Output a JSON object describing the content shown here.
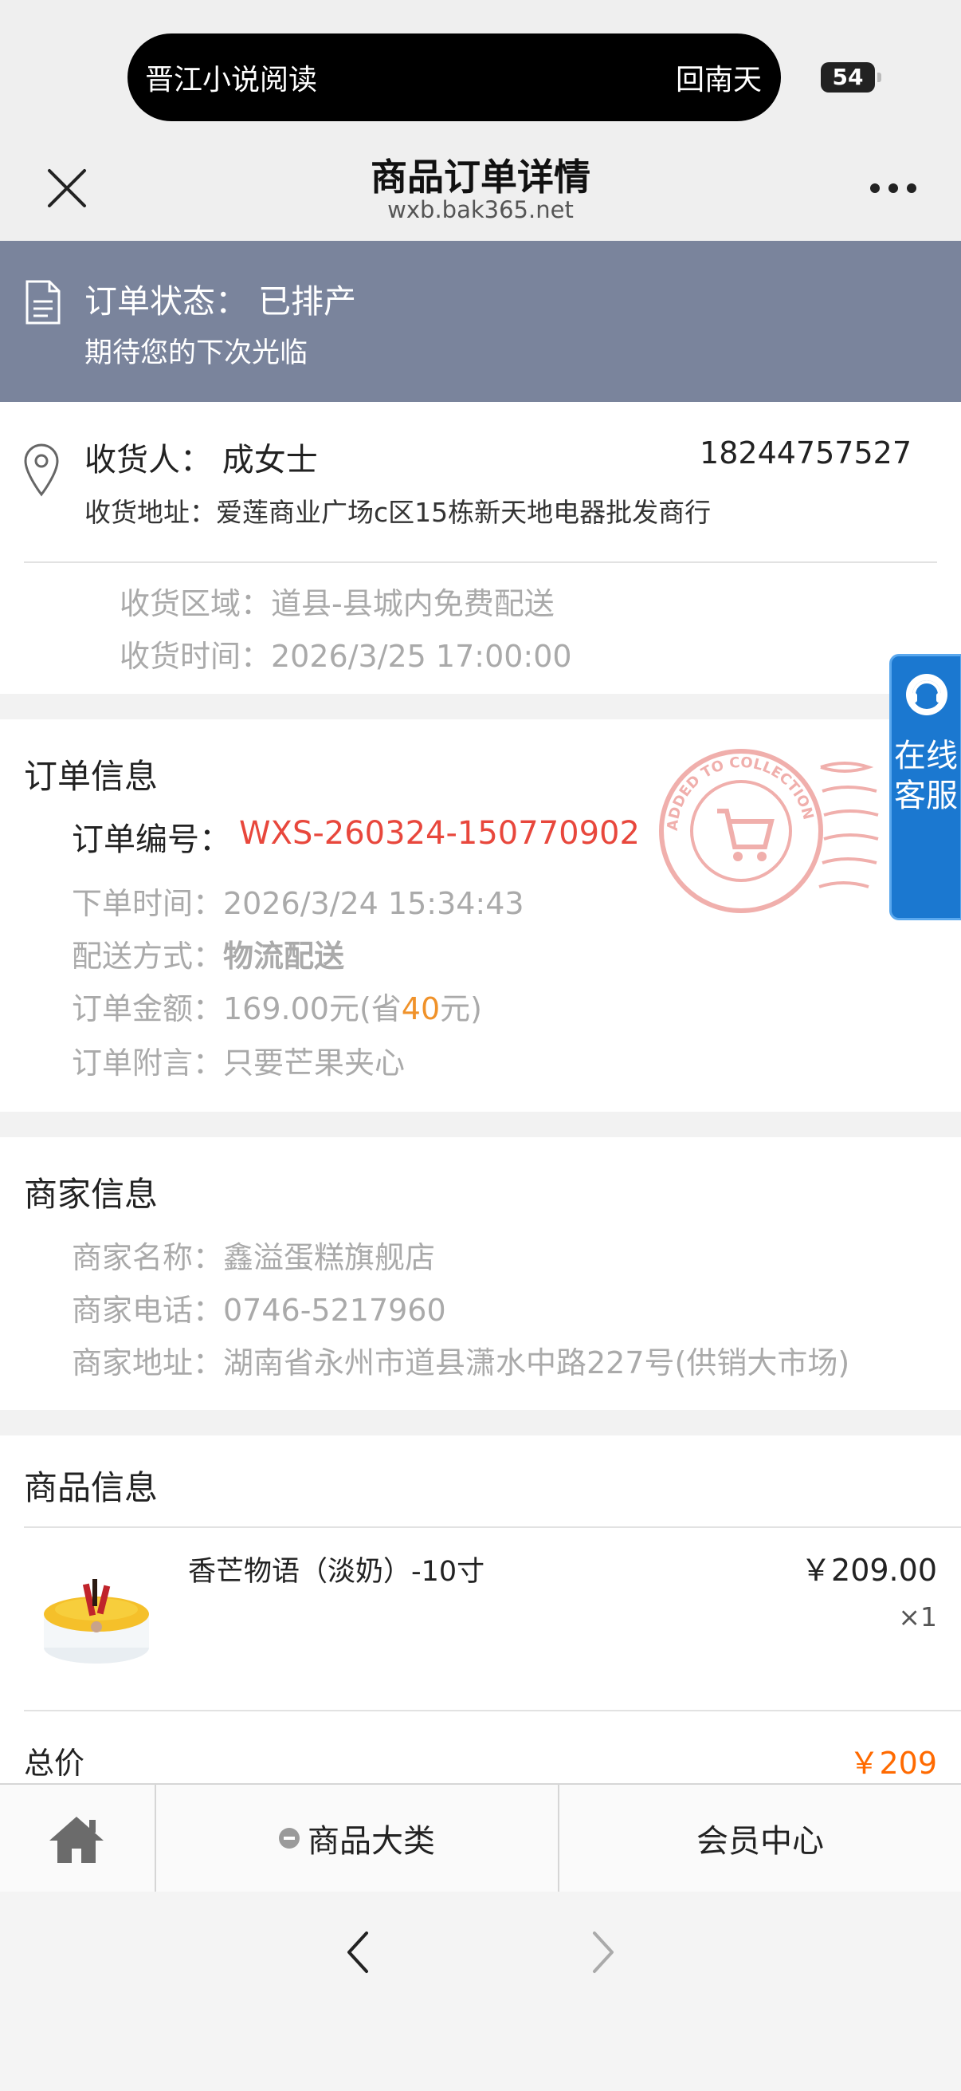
{
  "status_bar": {
    "left_text": "晋江小说阅读",
    "right_text": "回南天",
    "battery": "54"
  },
  "nav": {
    "title": "商品订单详情",
    "subtitle": "wxb.bak365.net"
  },
  "order_status": {
    "title": "订单状态： 已排产",
    "subtitle": "期待您的下次光临"
  },
  "address": {
    "receiver": "收货人： 成女士",
    "phone": "18244757527",
    "address": "收货地址：爱莲商业广场c区15栋新天地电器批发商行",
    "region": "收货区域：道县-县城内免费配送",
    "time": "收货时间：2026/3/25 17:00:00"
  },
  "order_info": {
    "section_title": "订单信息",
    "order_no_label": "订单编号：",
    "order_no": "WXS-260324-150770902",
    "order_time": "下单时间：2026/3/24 15:34:43",
    "delivery_label": "配送方式：",
    "delivery_value": "物流配送",
    "amount_prefix": "订单金额：169.00元(省",
    "amount_saved": "40",
    "amount_suffix": "元)",
    "note": "订单附言：只要芒果夹心",
    "stamp_text": "ADDED TO COLLECTION"
  },
  "merchant_info": {
    "section_title": "商家信息",
    "name": "商家名称：鑫溢蛋糕旗舰店",
    "phone": "商家电话：0746-5217960",
    "address": "商家地址：湖南省永州市道县潇水中路227号(供销大市场)"
  },
  "goods_info": {
    "section_title": "商品信息",
    "item_name": "香芒物语（淡奶）-10寸",
    "item_price": "￥209.00",
    "item_qty": "×1",
    "total_label": "总价",
    "total_value": "￥209"
  },
  "service_tab": {
    "label": "在线客服"
  },
  "bottom_nav": {
    "category": "商品大类",
    "member": "会员中心"
  },
  "colors": {
    "banner": "#7a849c",
    "order_no": "#e8473c",
    "saved": "#f0922a",
    "total": "#ff6a00",
    "service": "#1b78d0"
  }
}
